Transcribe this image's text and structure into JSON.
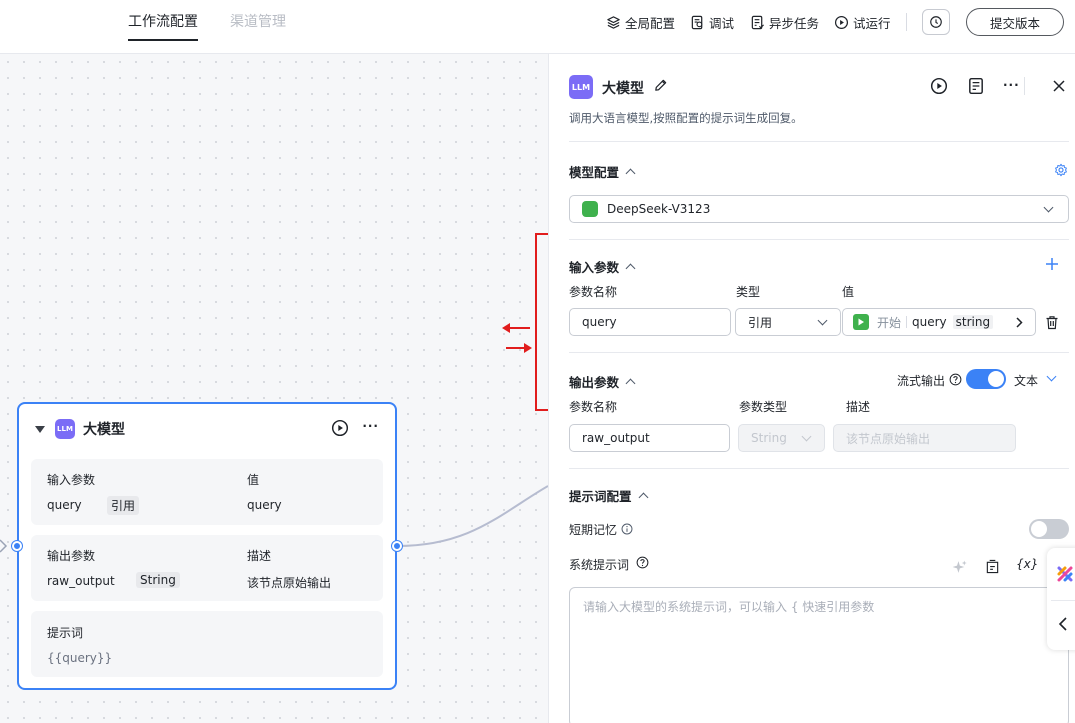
{
  "header": {
    "tabs": [
      {
        "label": "工作流配置"
      },
      {
        "label": "渠道管理"
      }
    ],
    "tools": {
      "global_config": "全局配置",
      "debug": "调试",
      "async_tasks": "异步任务",
      "trial_run": "试运行"
    },
    "submit_label": "提交版本"
  },
  "node": {
    "badge": "LLM",
    "title": "大模型",
    "input_header": "输入参数",
    "input_value_header": "值",
    "input_name": "query",
    "input_type": "引用",
    "input_value": "query",
    "output_header": "输出参数",
    "output_desc_header": "描述",
    "output_name": "raw_output",
    "output_type": "String",
    "output_desc": "该节点原始输出",
    "prompt_header": "提示词",
    "prompt_value": "{{query}}"
  },
  "panel": {
    "badge": "LLM",
    "title": "大模型",
    "description": "调用大语言模型,按照配置的提示词生成回复。",
    "model_section": "模型配置",
    "model_name": "DeepSeek-V3123",
    "input_section": "输入参数",
    "input_cols": {
      "name": "参数名称",
      "type": "类型",
      "value": "值"
    },
    "input_row": {
      "name": "query",
      "type": "引用",
      "value_source": "开始",
      "value_param": "query",
      "value_type": "string"
    },
    "output_section": "输出参数",
    "stream_label": "流式输出",
    "stream_on": true,
    "output_format": "文本",
    "output_cols": {
      "name": "参数名称",
      "type": "参数类型",
      "desc": "描述"
    },
    "output_row": {
      "name": "raw_output",
      "type": "String",
      "desc_placeholder": "该节点原始输出"
    },
    "prompt_section": "提示词配置",
    "short_memory_label": "短期记忆",
    "short_memory_on": false,
    "system_prompt_label": "系统提示词",
    "variable_icon_text": "{x}",
    "system_prompt_placeholder": "请输入大模型的系统提示词，可以输入 { 快速引用参数"
  },
  "colors": {
    "accent": "#3b82f6",
    "llm_badge": "#7b6cf6",
    "annotation": "#e11d1d",
    "model_icon": "#3fb14d"
  }
}
